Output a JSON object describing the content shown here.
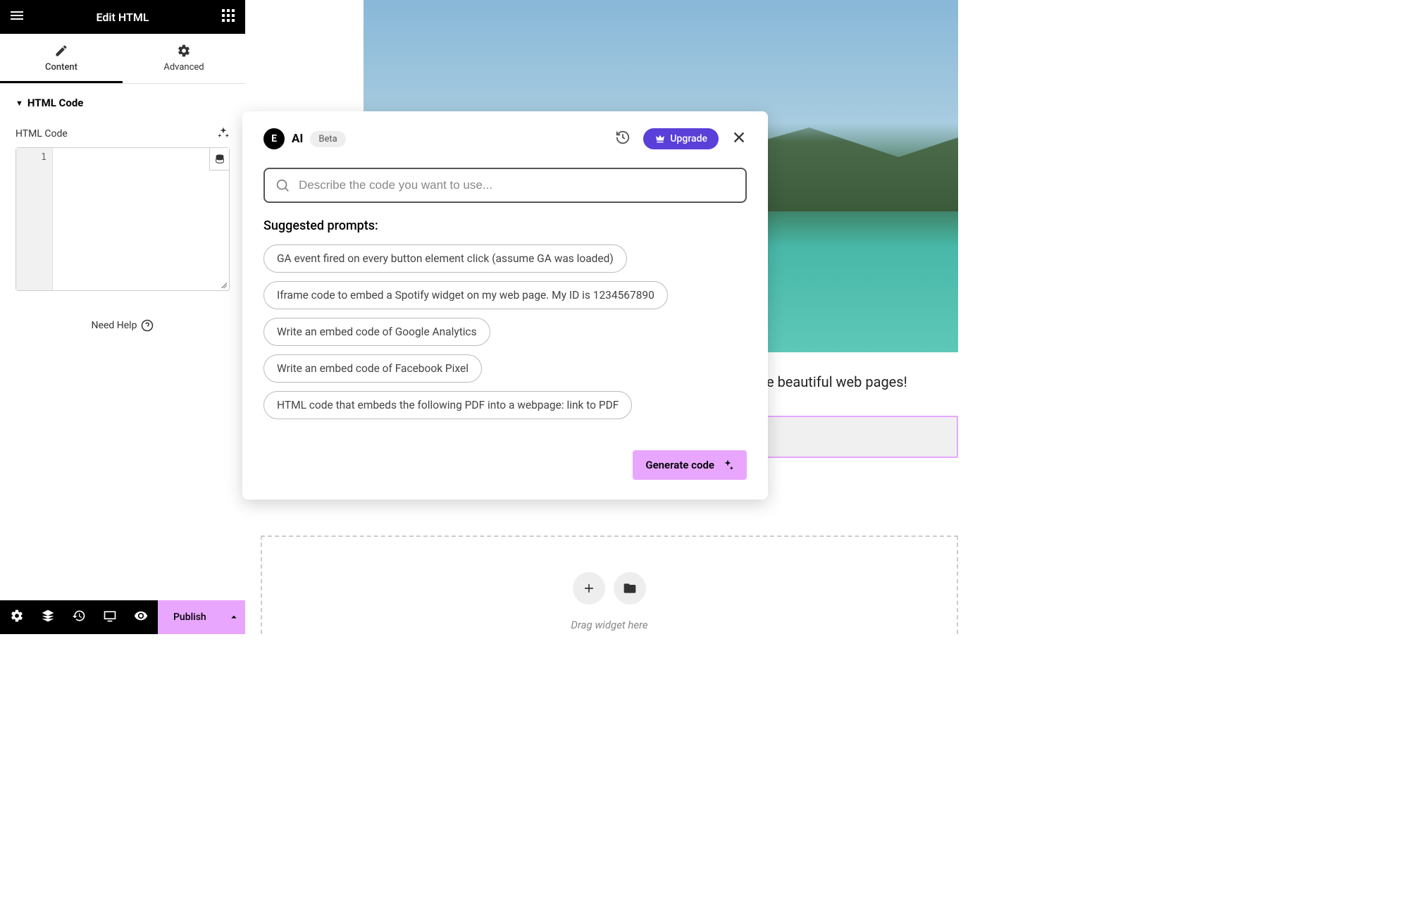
{
  "sidebar": {
    "title": "Edit HTML",
    "tabs": {
      "content": "Content",
      "advanced": "Advanced"
    },
    "section_title": "HTML Code",
    "field_label": "HTML Code",
    "line_number": "1",
    "need_help": "Need Help"
  },
  "footer": {
    "publish": "Publish"
  },
  "modal": {
    "logo_text": "E",
    "title": "AI",
    "badge": "Beta",
    "upgrade": "Upgrade",
    "search_placeholder": "Describe the code you want to use...",
    "suggested_title": "Suggested prompts:",
    "prompts": [
      "GA event fired on every button element click (assume GA was loaded)",
      "Iframe code to embed a Spotify widget on my web page. My ID is 1234567890",
      "Write an embed code of Google Analytics",
      "Write an embed code of Facebook Pixel",
      "HTML code that embeds the following PDF into a webpage: link to PDF"
    ],
    "generate": "Generate code"
  },
  "canvas": {
    "tagline_fragment": "e beautiful web pages!",
    "drop_text": "Drag widget here"
  }
}
